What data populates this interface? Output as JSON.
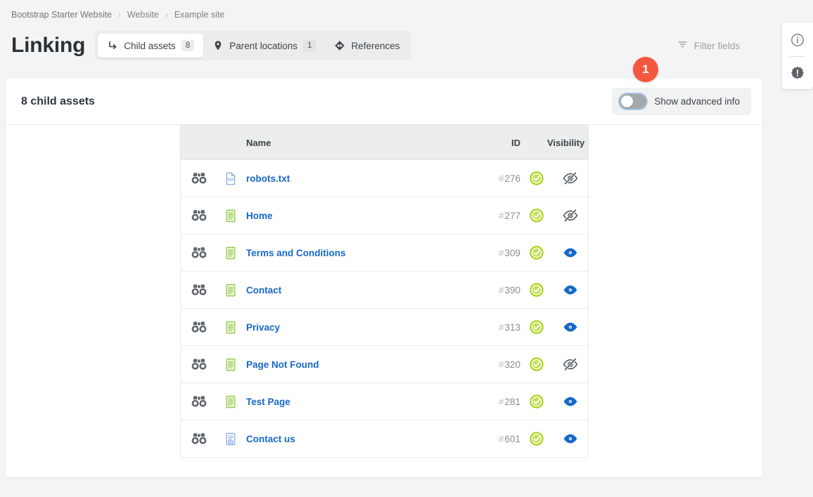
{
  "breadcrumb": {
    "items": [
      {
        "label": "Bootstrap Starter Website"
      },
      {
        "label": "Website"
      },
      {
        "label": "Example site"
      }
    ],
    "separator": "›"
  },
  "header": {
    "title": "Linking",
    "tabs": [
      {
        "label": "Child assets",
        "count": "8",
        "icon": "arrow-turn-down-right-icon",
        "active": true
      },
      {
        "label": "Parent locations",
        "count": "1",
        "icon": "map-pin-icon",
        "active": false
      },
      {
        "label": "References",
        "count": "",
        "icon": "diamond-arrows-icon",
        "active": false
      }
    ],
    "filter_fields_label": "Filter fields",
    "filter_fields_icon": "filter-icon"
  },
  "tool_panel": {
    "info_icon": "info-circle-icon",
    "alert_icon": "alert-badge-icon"
  },
  "card": {
    "title": "8 child assets",
    "advanced_toggle": {
      "label": "Show advanced info",
      "state": "off"
    },
    "step_badge": "1"
  },
  "table": {
    "columns": {
      "watch": "",
      "type": "",
      "name": "Name",
      "id": "ID",
      "state": "",
      "visibility": "Visibility"
    },
    "rows": [
      {
        "watch_icon": "binoculars-icon",
        "type_icon": "file-txt-icon",
        "name": "robots.txt",
        "id": "276",
        "status_icon": "check-circle-icon",
        "visibility_icon": "eye-off-icon"
      },
      {
        "watch_icon": "binoculars-icon",
        "type_icon": "page-icon",
        "name": "Home",
        "id": "277",
        "status_icon": "check-circle-icon",
        "visibility_icon": "eye-off-icon"
      },
      {
        "watch_icon": "binoculars-icon",
        "type_icon": "page-icon",
        "name": "Terms and Conditions",
        "id": "309",
        "status_icon": "check-circle-icon",
        "visibility_icon": "eye-icon"
      },
      {
        "watch_icon": "binoculars-icon",
        "type_icon": "page-icon",
        "name": "Contact",
        "id": "390",
        "status_icon": "check-circle-icon",
        "visibility_icon": "eye-icon"
      },
      {
        "watch_icon": "binoculars-icon",
        "type_icon": "page-icon",
        "name": "Privacy",
        "id": "313",
        "status_icon": "check-circle-icon",
        "visibility_icon": "eye-icon"
      },
      {
        "watch_icon": "binoculars-icon",
        "type_icon": "page-icon",
        "name": "Page Not Found",
        "id": "320",
        "status_icon": "check-circle-icon",
        "visibility_icon": "eye-off-icon"
      },
      {
        "watch_icon": "binoculars-icon",
        "type_icon": "page-icon",
        "name": "Test Page",
        "id": "281",
        "status_icon": "check-circle-icon",
        "visibility_icon": "eye-icon"
      },
      {
        "watch_icon": "binoculars-icon",
        "type_icon": "form-icon",
        "name": "Contact us",
        "id": "601",
        "status_icon": "check-circle-icon",
        "visibility_icon": "eye-icon"
      }
    ],
    "id_prefix": "#"
  },
  "colors": {
    "page_bg": "#f4f4f4",
    "link": "#1668c7",
    "status_green": "#a8d215",
    "eye_blue": "#1668c7",
    "badge_red": "#f4573f",
    "muted": "#868d93"
  }
}
